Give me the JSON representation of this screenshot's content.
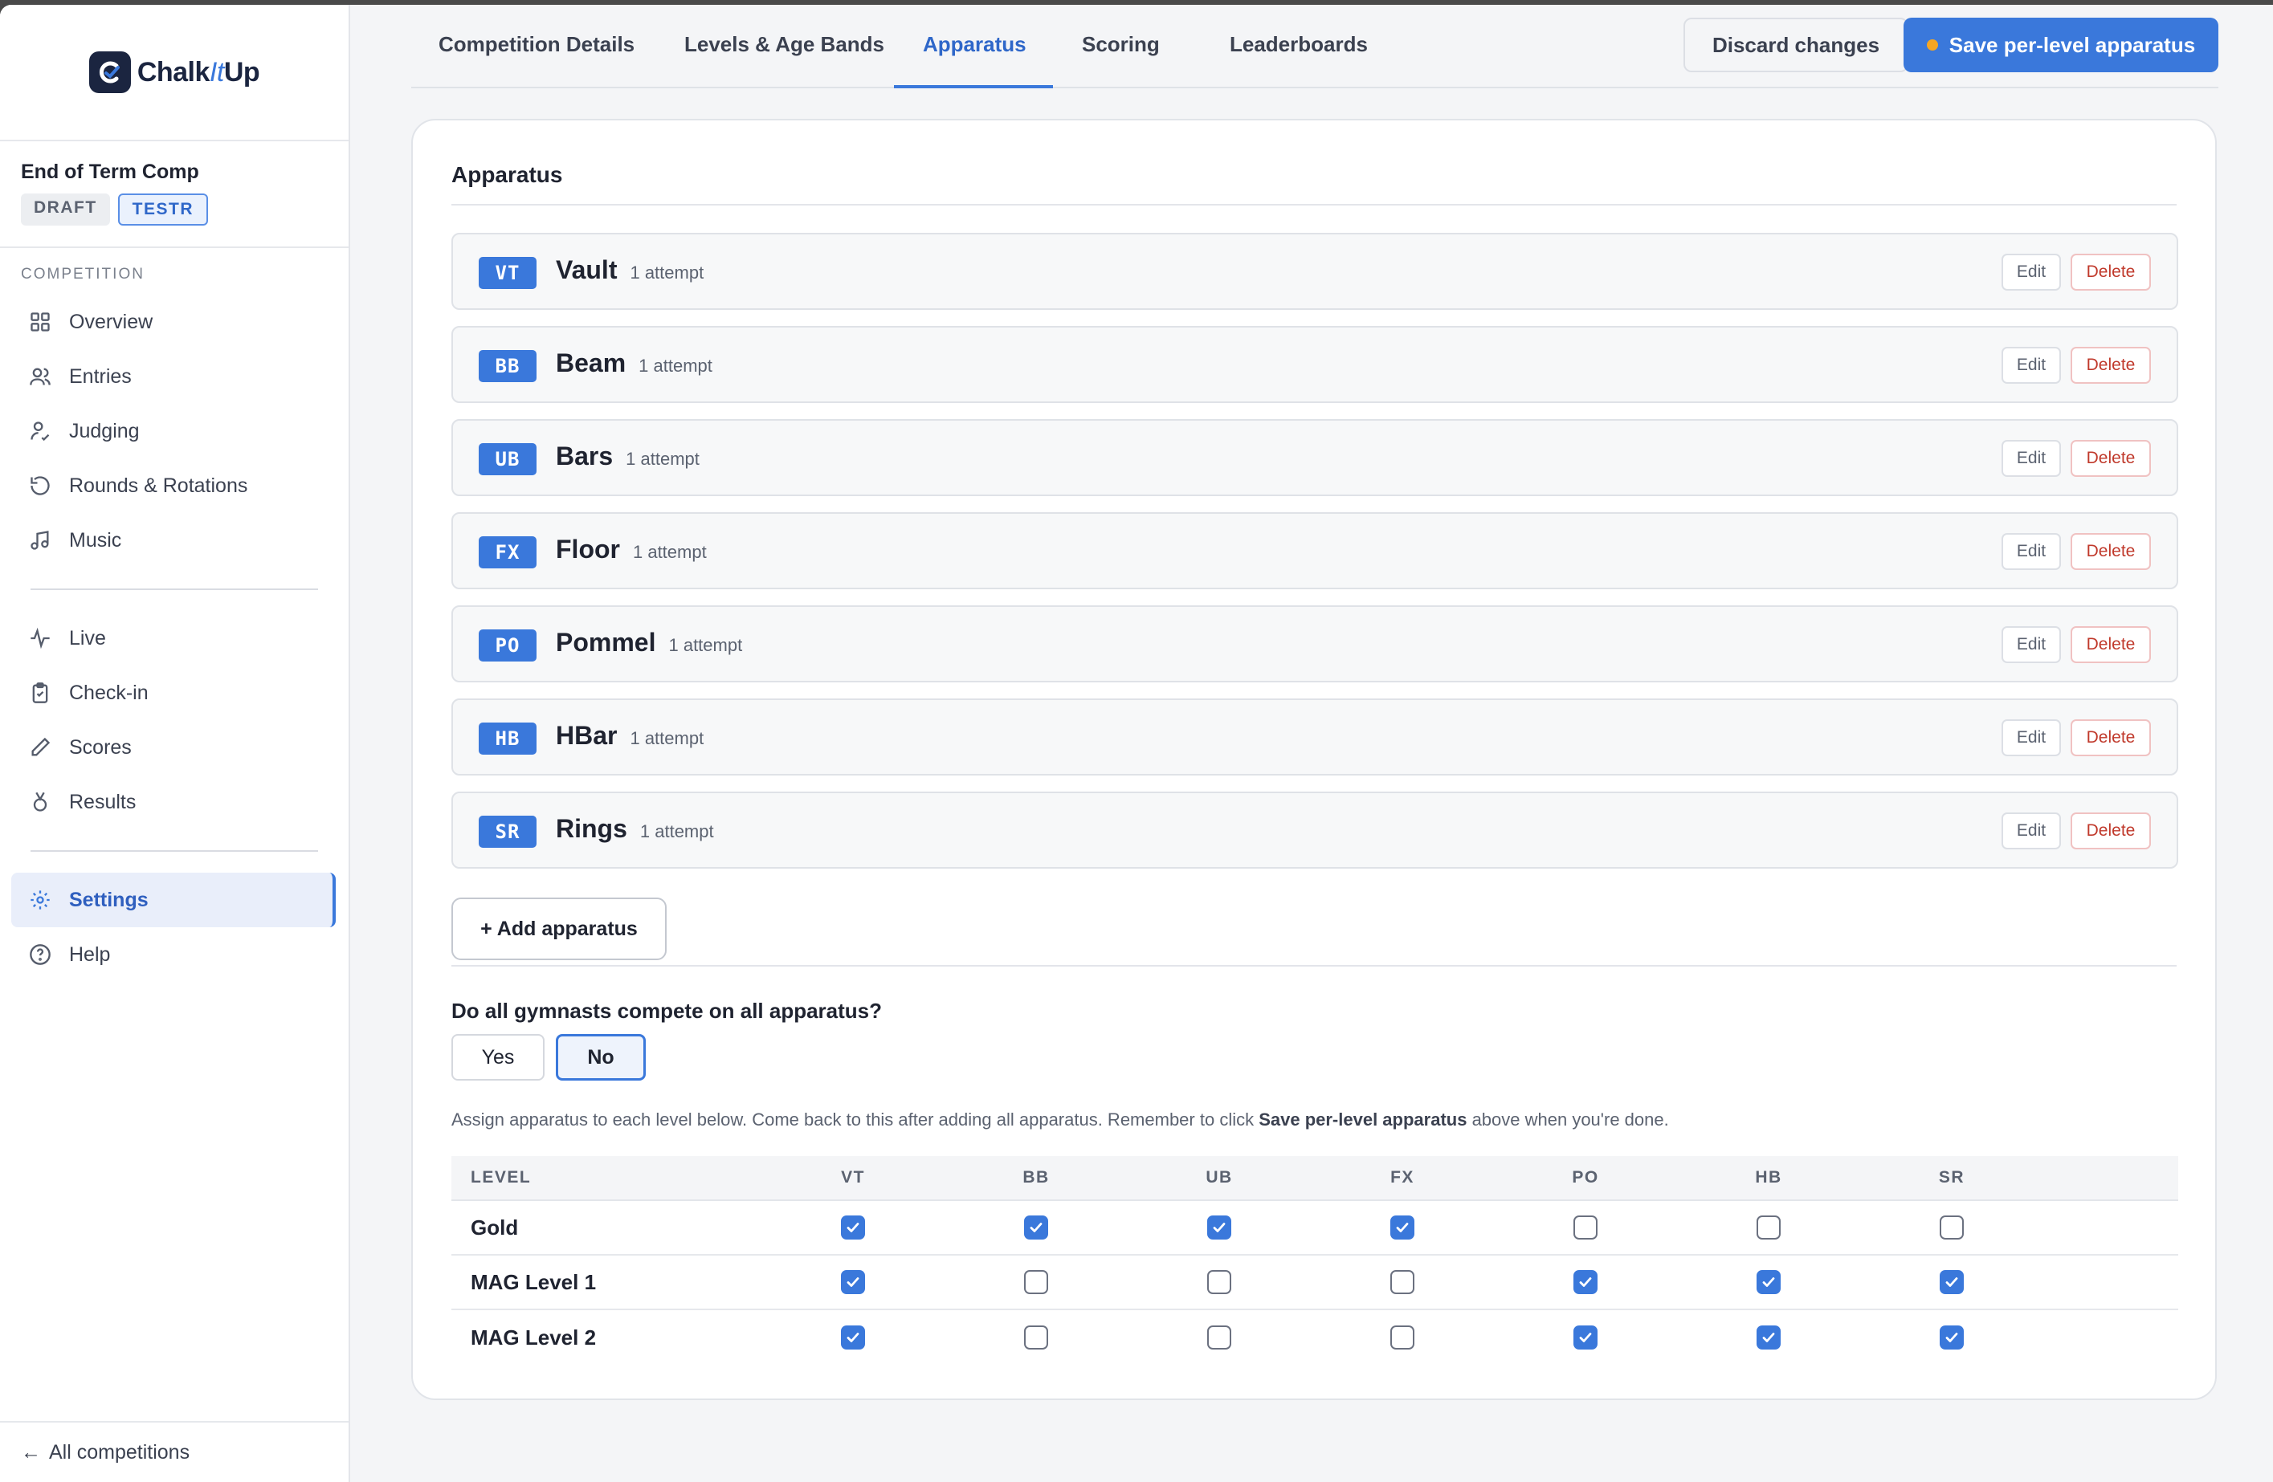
{
  "brand": {
    "name_left": "Chalk",
    "name_mid": "It",
    "name_right": "Up"
  },
  "competition": {
    "name": "End of Term Comp",
    "badges": [
      "DRAFT",
      "TESTR"
    ]
  },
  "sidebar": {
    "section_label": "COMPETITION",
    "group1": [
      {
        "label": "Overview",
        "icon": "grid-icon"
      },
      {
        "label": "Entries",
        "icon": "users-icon"
      },
      {
        "label": "Judging",
        "icon": "judge-icon"
      },
      {
        "label": "Rounds & Rotations",
        "icon": "rotate-icon"
      },
      {
        "label": "Music",
        "icon": "music-icon"
      }
    ],
    "group2": [
      {
        "label": "Live",
        "icon": "pulse-icon"
      },
      {
        "label": "Check-in",
        "icon": "clipboard-icon"
      },
      {
        "label": "Scores",
        "icon": "pencil-icon"
      },
      {
        "label": "Results",
        "icon": "medal-icon"
      }
    ],
    "group3": [
      {
        "label": "Settings",
        "icon": "gear-icon",
        "active": true
      },
      {
        "label": "Help",
        "icon": "help-icon"
      }
    ],
    "back_link": "All competitions"
  },
  "tabs": [
    "Competition Details",
    "Levels & Age Bands",
    "Apparatus",
    "Scoring",
    "Leaderboards"
  ],
  "active_tab": "Apparatus",
  "actions": {
    "discard": "Discard changes",
    "save": "Save per-level apparatus"
  },
  "apparatus_section": {
    "title": "Apparatus",
    "items": [
      {
        "code": "VT",
        "name": "Vault",
        "attempts": "1 attempt"
      },
      {
        "code": "BB",
        "name": "Beam",
        "attempts": "1 attempt"
      },
      {
        "code": "UB",
        "name": "Bars",
        "attempts": "1 attempt"
      },
      {
        "code": "FX",
        "name": "Floor",
        "attempts": "1 attempt"
      },
      {
        "code": "PO",
        "name": "Pommel",
        "attempts": "1 attempt"
      },
      {
        "code": "HB",
        "name": "HBar",
        "attempts": "1 attempt"
      },
      {
        "code": "SR",
        "name": "Rings",
        "attempts": "1 attempt"
      }
    ],
    "edit_label": "Edit",
    "delete_label": "Delete",
    "add_label": "+ Add apparatus"
  },
  "all_apparatus": {
    "question": "Do all gymnasts compete on all apparatus?",
    "yes": "Yes",
    "no": "No",
    "selected": "No",
    "help_prefix": "Assign apparatus to each level below. Come back to this after adding all apparatus. Remember to click ",
    "help_bold": "Save per-level apparatus",
    "help_suffix": " above when you're done."
  },
  "level_table": {
    "columns": [
      "LEVEL",
      "VT",
      "BB",
      "UB",
      "FX",
      "PO",
      "HB",
      "SR"
    ],
    "rows": [
      {
        "level": "Gold",
        "checks": [
          true,
          true,
          true,
          true,
          false,
          false,
          false
        ]
      },
      {
        "level": "MAG Level 1",
        "checks": [
          true,
          false,
          false,
          false,
          true,
          true,
          true
        ]
      },
      {
        "level": "MAG Level 2",
        "checks": [
          true,
          false,
          false,
          false,
          true,
          true,
          true
        ]
      }
    ]
  },
  "colors": {
    "accent": "#3a78db",
    "danger": "#c0392b",
    "unsaved_dot": "#f5a623"
  }
}
